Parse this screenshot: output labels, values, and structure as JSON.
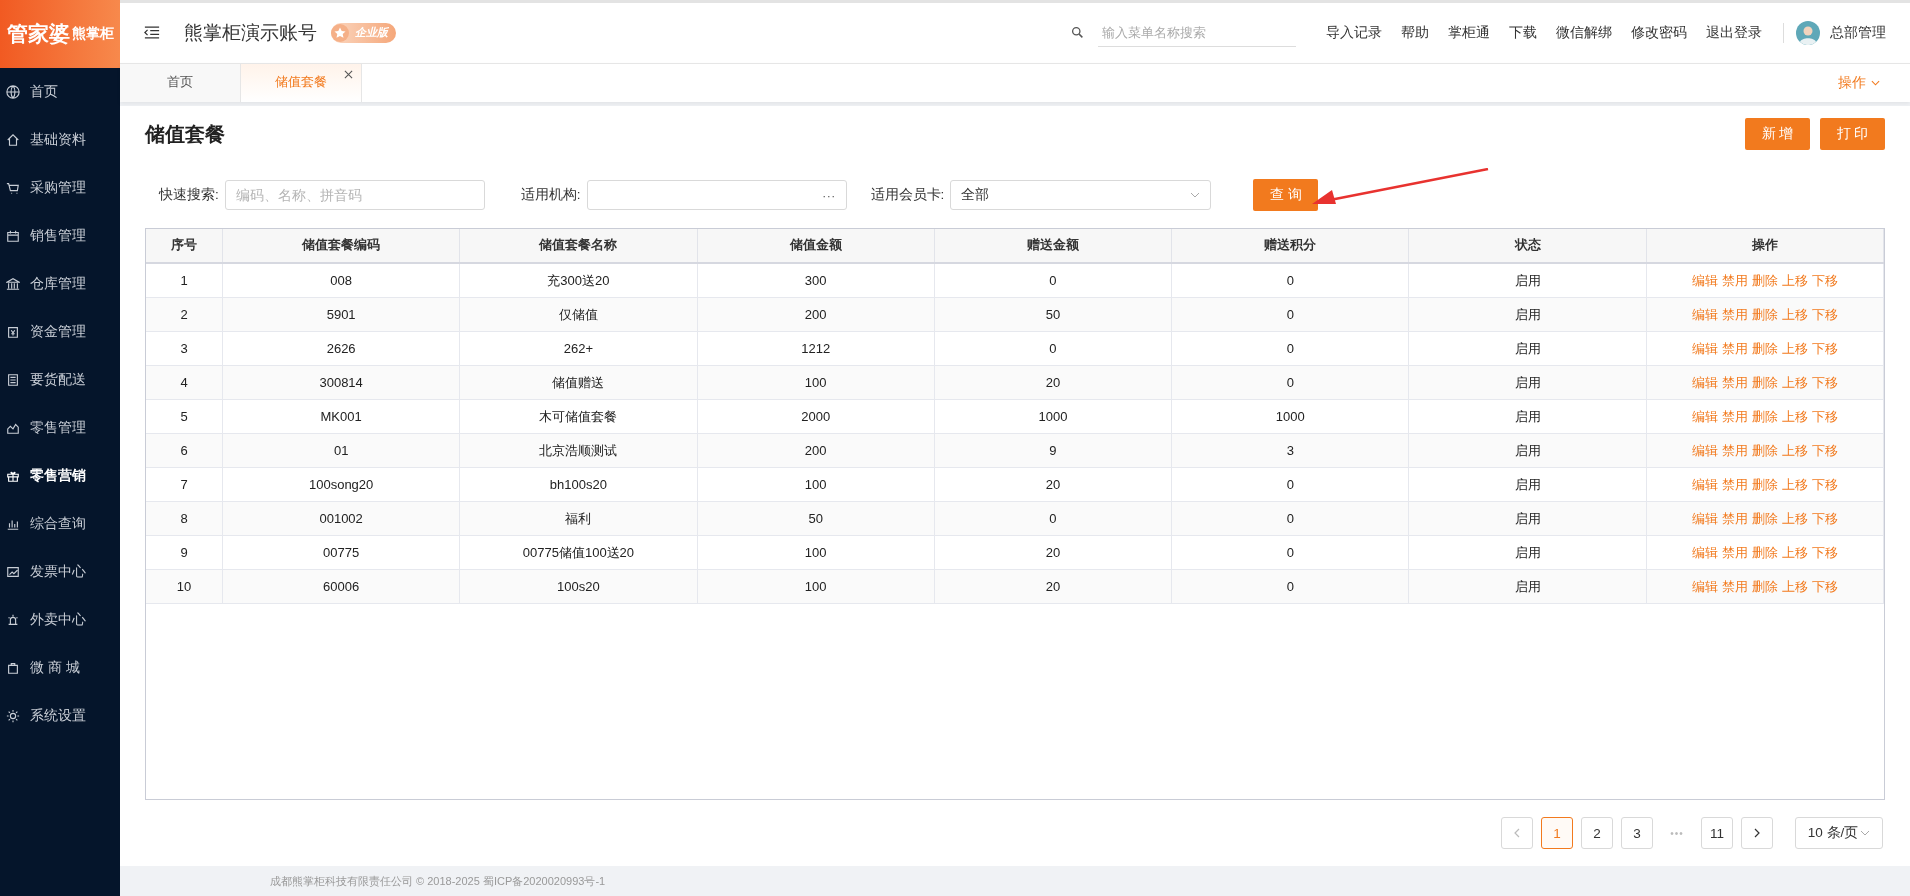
{
  "brand": {
    "logo_main": "管家婆",
    "logo_sub": "熊掌柜"
  },
  "sidebar": {
    "items": [
      {
        "label": "首页",
        "selected": false
      },
      {
        "label": "基础资料",
        "selected": false
      },
      {
        "label": "采购管理",
        "selected": false
      },
      {
        "label": "销售管理",
        "selected": false
      },
      {
        "label": "仓库管理",
        "selected": false
      },
      {
        "label": "资金管理",
        "selected": false
      },
      {
        "label": "要货配送",
        "selected": false
      },
      {
        "label": "零售管理",
        "selected": false
      },
      {
        "label": "零售营销",
        "selected": true
      },
      {
        "label": "综合查询",
        "selected": false
      },
      {
        "label": "发票中心",
        "selected": false
      },
      {
        "label": "外卖中心",
        "selected": false
      },
      {
        "label": "微 商 城",
        "selected": false
      },
      {
        "label": "系统设置",
        "selected": false
      }
    ]
  },
  "header": {
    "account": "熊掌柜演示账号",
    "edition": "企业版",
    "search": {
      "placeholder": "输入菜单名称搜索"
    },
    "links": [
      "导入记录",
      "帮助",
      "掌柜通",
      "下载",
      "微信解绑",
      "修改密码",
      "退出登录"
    ],
    "user": "总部管理"
  },
  "tabs": [
    {
      "label": "首页",
      "selected": false,
      "closable": false
    },
    {
      "label": "储值套餐",
      "selected": true,
      "closable": true
    }
  ],
  "tab_menu": "操作",
  "page": {
    "title": "储值套餐",
    "buttons": [
      "新 增",
      "打 印"
    ]
  },
  "filters": {
    "quick_search": {
      "label": "快速搜索:",
      "placeholder": "编码、名称、拼音码"
    },
    "org": {
      "label": "适用机构:",
      "button": "···"
    },
    "card": {
      "label": "适用会员卡:",
      "value": "全部"
    },
    "query_button": "查 询"
  },
  "table": {
    "columns": [
      "序号",
      "储值套餐编码",
      "储值套餐名称",
      "储值金额",
      "赠送金额",
      "赠送积分",
      "状态",
      "操作"
    ],
    "rows": [
      {
        "cells": [
          "1",
          "008",
          "充300送20",
          "300",
          "0",
          "0",
          "启用"
        ],
        "actions": [
          "编辑",
          "禁用",
          "删除",
          "上移",
          "下移"
        ]
      },
      {
        "cells": [
          "2",
          "5901",
          "仅储值",
          "200",
          "50",
          "0",
          "启用"
        ],
        "actions": [
          "编辑",
          "禁用",
          "删除",
          "上移",
          "下移"
        ]
      },
      {
        "cells": [
          "3",
          "2626",
          "262+",
          "1212",
          "0",
          "0",
          "启用"
        ],
        "actions": [
          "编辑",
          "禁用",
          "删除",
          "上移",
          "下移"
        ]
      },
      {
        "cells": [
          "4",
          "300814",
          "储值赠送",
          "100",
          "20",
          "0",
          "启用"
        ],
        "actions": [
          "编辑",
          "禁用",
          "删除",
          "上移",
          "下移"
        ]
      },
      {
        "cells": [
          "5",
          "MK001",
          "木可储值套餐",
          "2000",
          "1000",
          "1000",
          "启用"
        ],
        "actions": [
          "编辑",
          "禁用",
          "删除",
          "上移",
          "下移"
        ]
      },
      {
        "cells": [
          "6",
          "01",
          "北京浩顺测试",
          "200",
          "9",
          "3",
          "启用"
        ],
        "actions": [
          "编辑",
          "禁用",
          "删除",
          "上移",
          "下移"
        ]
      },
      {
        "cells": [
          "7",
          "100song20",
          "bh100s20",
          "100",
          "20",
          "0",
          "启用"
        ],
        "actions": [
          "编辑",
          "禁用",
          "删除",
          "上移",
          "下移"
        ]
      },
      {
        "cells": [
          "8",
          "001002",
          "福利",
          "50",
          "0",
          "0",
          "启用"
        ],
        "actions": [
          "编辑",
          "禁用",
          "删除",
          "上移",
          "下移"
        ]
      },
      {
        "cells": [
          "9",
          "00775",
          "00775储值100送20",
          "100",
          "20",
          "0",
          "启用"
        ],
        "actions": [
          "编辑",
          "禁用",
          "删除",
          "上移",
          "下移"
        ]
      },
      {
        "cells": [
          "10",
          "60006",
          "100s20",
          "100",
          "20",
          "0",
          "启用"
        ],
        "actions": [
          "编辑",
          "禁用",
          "删除",
          "上移",
          "下移"
        ]
      }
    ]
  },
  "pagination": {
    "pages": [
      {
        "label": "1",
        "selected": true
      },
      {
        "label": "2",
        "selected": false
      },
      {
        "label": "3",
        "selected": false
      },
      {
        "label": "•••",
        "kind": "ellipsis"
      },
      {
        "label": "11",
        "selected": false
      }
    ],
    "page_size": "10 条/页"
  },
  "footer": "成都熊掌柜科技有限责任公司 © 2018-2025 蜀ICP备2020020993号-1"
}
